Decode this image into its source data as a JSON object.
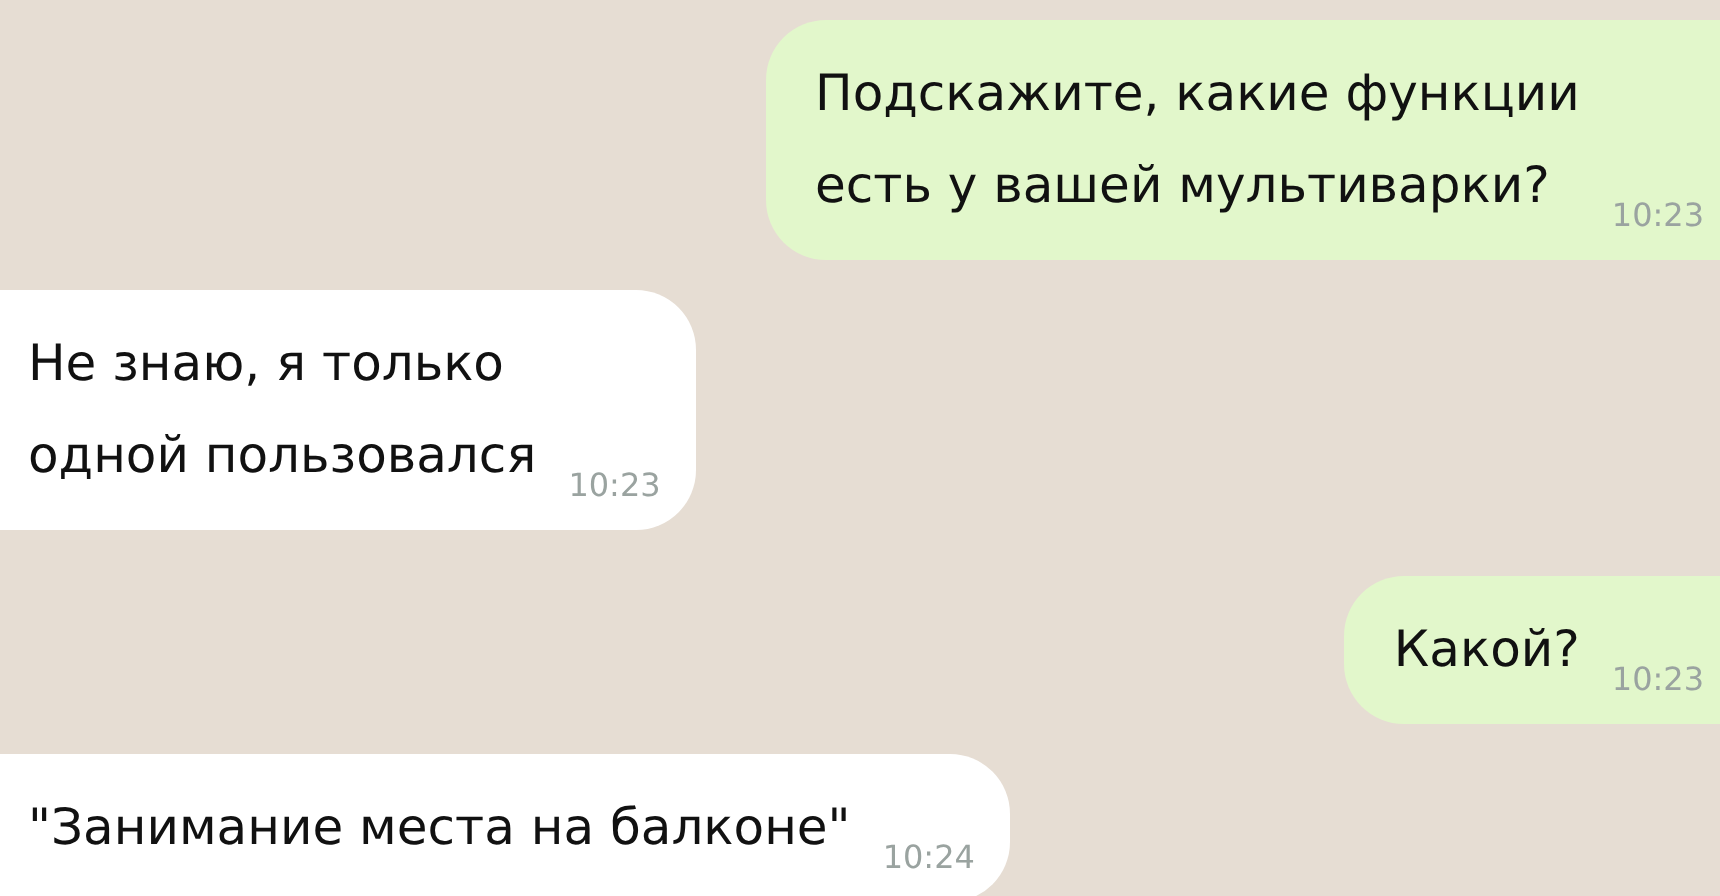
{
  "messages": [
    {
      "kind": "outgoing",
      "text": "Подскажите, какие функции\nесть у вашей мультиварки?",
      "time": "10:23"
    },
    {
      "kind": "incoming",
      "text": "Не знаю, я только\nодной пользовался",
      "time": "10:23"
    },
    {
      "kind": "outgoing",
      "text": "Какой?",
      "time": "10:23"
    },
    {
      "kind": "incoming",
      "text": "\"Занимание места на балконе\"",
      "time": "10:24"
    }
  ]
}
